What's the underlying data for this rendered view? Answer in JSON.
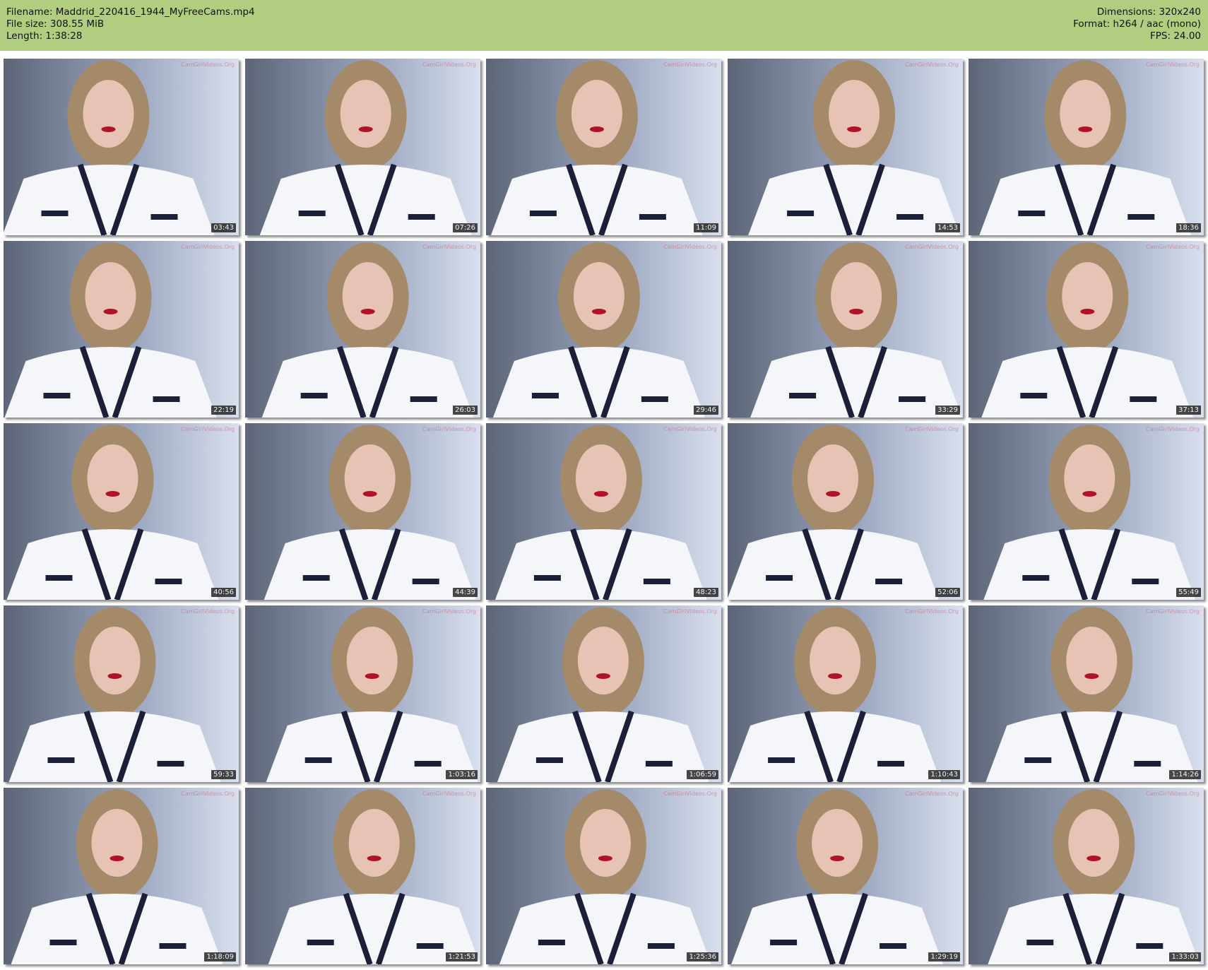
{
  "header": {
    "filename": "Filename: Maddrid_220416_1944_MyFreeCams.mp4",
    "filesize": "File size: 308.55 MiB",
    "length": "Length: 1:38:28",
    "dimensions": "Dimensions: 320x240",
    "format": "Format: h264 / aac (mono)",
    "fps": "FPS: 24.00"
  },
  "watermark": "CamGirlVideos.Org",
  "thumbnails": [
    {
      "timestamp": "03:43"
    },
    {
      "timestamp": "07:26"
    },
    {
      "timestamp": "11:09"
    },
    {
      "timestamp": "14:53"
    },
    {
      "timestamp": "18:36"
    },
    {
      "timestamp": "22:19"
    },
    {
      "timestamp": "26:03"
    },
    {
      "timestamp": "29:46"
    },
    {
      "timestamp": "33:29"
    },
    {
      "timestamp": "37:13"
    },
    {
      "timestamp": "40:56"
    },
    {
      "timestamp": "44:39"
    },
    {
      "timestamp": "48:23"
    },
    {
      "timestamp": "52:06"
    },
    {
      "timestamp": "55:49"
    },
    {
      "timestamp": "59:33"
    },
    {
      "timestamp": "1:03:16"
    },
    {
      "timestamp": "1:06:59"
    },
    {
      "timestamp": "1:10:43"
    },
    {
      "timestamp": "1:14:26"
    },
    {
      "timestamp": "1:18:09"
    },
    {
      "timestamp": "1:21:53"
    },
    {
      "timestamp": "1:25:36"
    },
    {
      "timestamp": "1:29:19"
    },
    {
      "timestamp": "1:33:03"
    }
  ],
  "colors": {
    "header_bg": "#b1cd80",
    "wall": "#9aa6bf",
    "shirt": "#f4f6fa",
    "trim": "#1b2038",
    "hair": "#a48a68"
  }
}
